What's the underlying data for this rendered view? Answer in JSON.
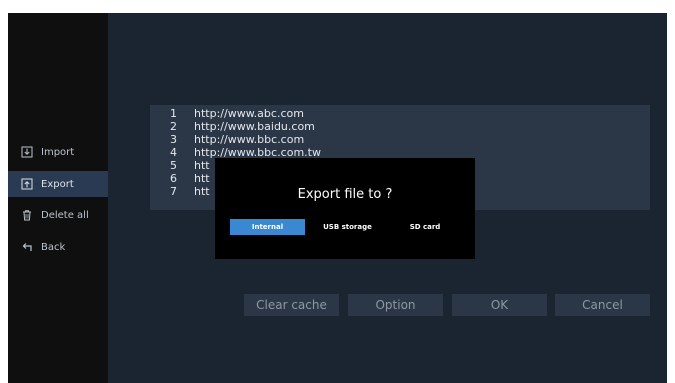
{
  "sidebar": {
    "items": [
      {
        "label": "Import",
        "icon": "import-icon"
      },
      {
        "label": "Export",
        "icon": "export-icon",
        "active": true
      },
      {
        "label": "Delete all",
        "icon": "trash-icon"
      },
      {
        "label": "Back",
        "icon": "back-arrow-icon"
      }
    ]
  },
  "url_list": [
    {
      "num": "1",
      "url": "http://www.abc.com"
    },
    {
      "num": "2",
      "url": "http://www.baidu.com"
    },
    {
      "num": "3",
      "url": "http://www.bbc.com"
    },
    {
      "num": "4",
      "url": "http://www.bbc.com.tw"
    },
    {
      "num": "5",
      "url": "htt"
    },
    {
      "num": "6",
      "url": "htt"
    },
    {
      "num": "7",
      "url": "htt"
    }
  ],
  "buttons": {
    "clear_cache": "Clear cache",
    "option": "Option",
    "ok": "OK",
    "cancel": "Cancel"
  },
  "dialog": {
    "title": "Export file to ?",
    "options": [
      {
        "label": "Internal",
        "selected": true
      },
      {
        "label": "USB storage",
        "selected": false
      },
      {
        "label": "SD card",
        "selected": false
      }
    ]
  },
  "colors": {
    "screen_bg": "#1b2431",
    "sidebar_bg": "#0f0f0f",
    "panel_bg": "#2b3747",
    "selected_accent": "#3a87d2",
    "dialog_bg": "#000000"
  }
}
